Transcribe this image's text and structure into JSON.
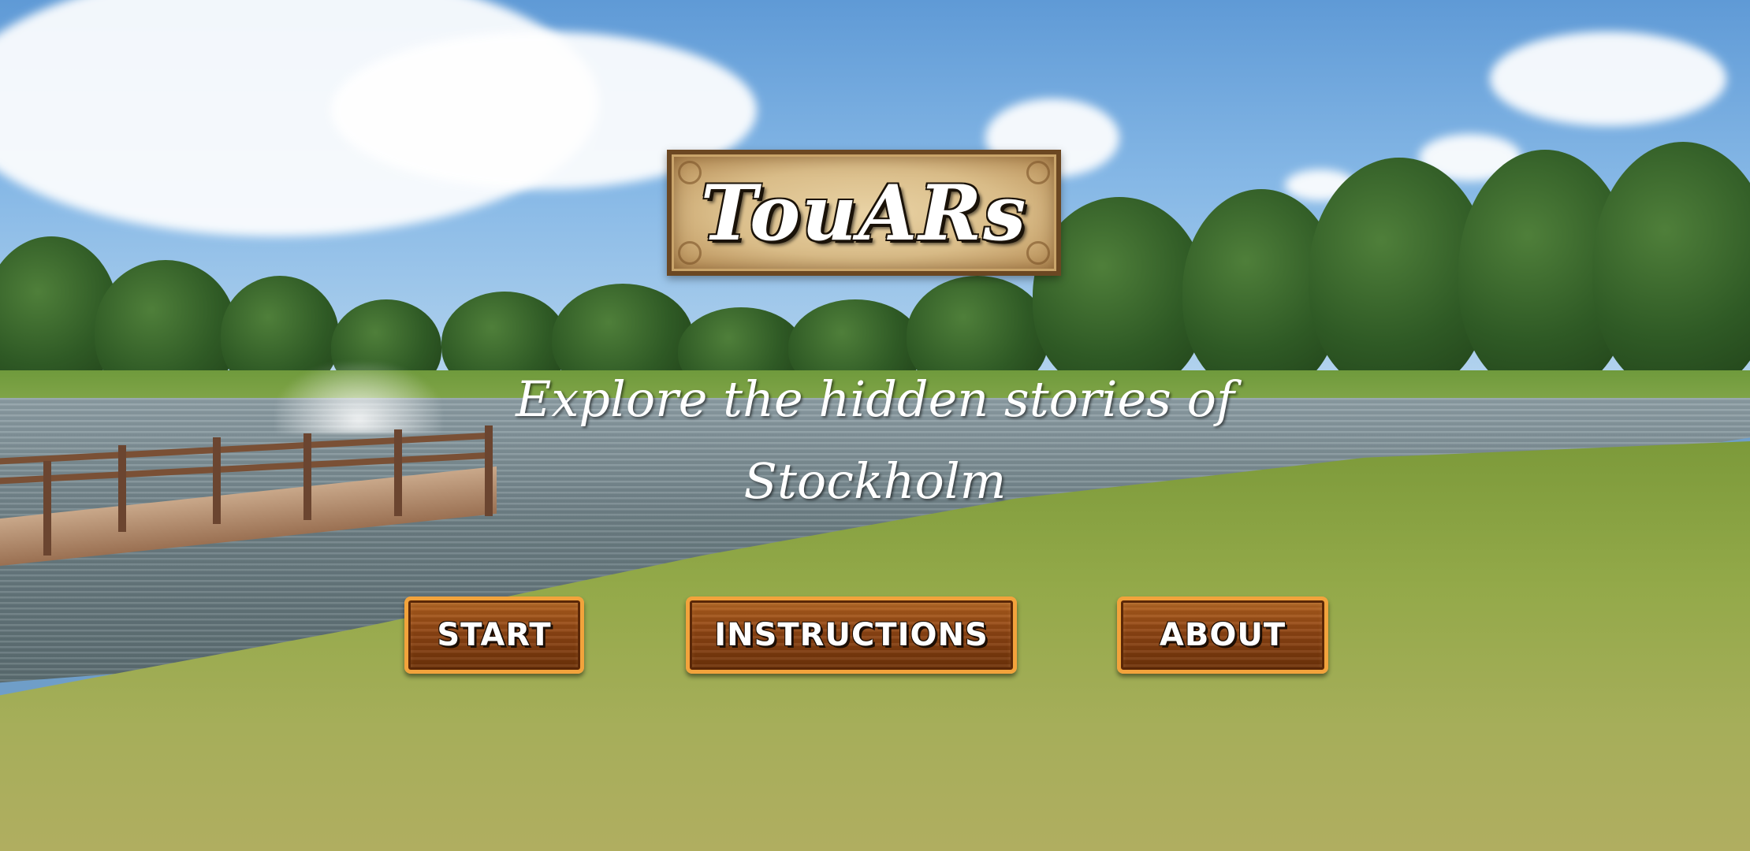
{
  "app": {
    "title": "TouARs",
    "subtitle_line1": "Explore the hidden stories of",
    "subtitle_line2": "Stockholm"
  },
  "menu": {
    "start_label": "START",
    "instructions_label": "INSTRUCTIONS",
    "about_label": "ABOUT"
  },
  "colors": {
    "button_border": "#f2a33c",
    "button_wood": "#8f4513",
    "sign_parchment": "#d9bc88",
    "text": "#ffffff"
  }
}
